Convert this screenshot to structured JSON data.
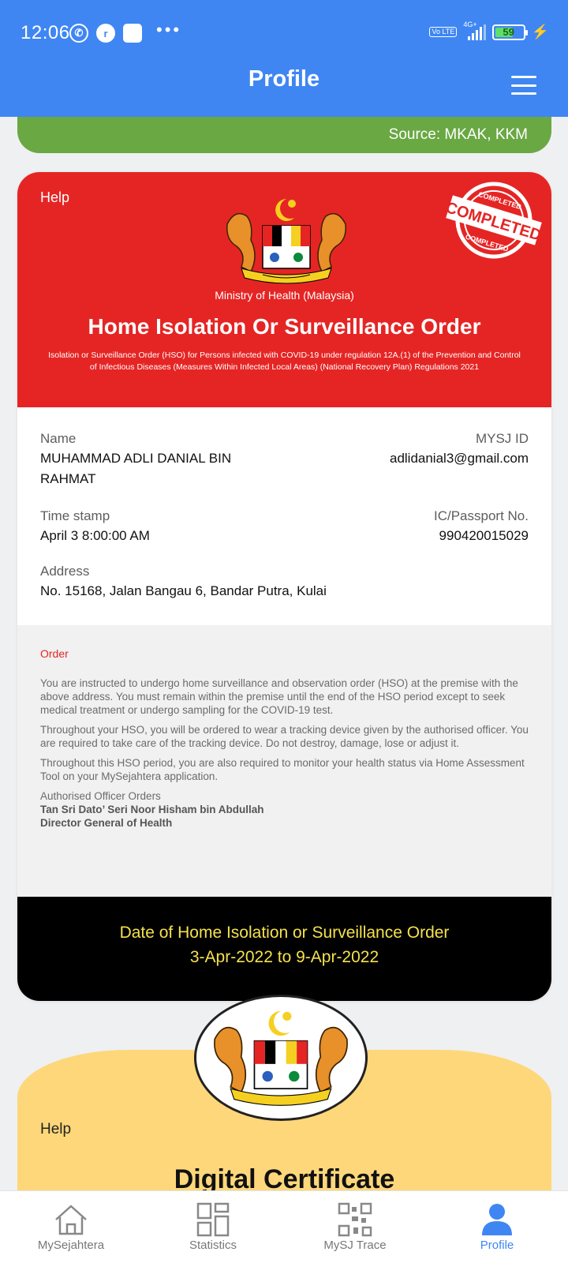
{
  "status_bar": {
    "time": "12:06",
    "network": "4G+",
    "volte": "Vo LTE",
    "battery": "59"
  },
  "header": {
    "title": "Profile"
  },
  "source_banner": {
    "text": "Source: MKAK, KKM"
  },
  "order_card": {
    "help": "Help",
    "stamp_text": "COMPLETED",
    "ministry": "Ministry of Health (Malaysia)",
    "title": "Home Isolation Or Surveillance Order",
    "subtitle": "Isolation or Surveillance Order (HSO) for Persons infected with COVID-19 under regulation 12A.(1) of the Prevention and Control of Infectious Diseases (Measures Within Infected Local Areas) (National Recovery Plan) Regulations 2021",
    "name_label": "Name",
    "name_line1": "MUHAMMAD ADLI DANIAL BIN",
    "name_line2": "RAHMAT",
    "mysj_label": "MYSJ ID",
    "mysj_value": "adlidanial3@gmail.com",
    "timestamp_label": "Time stamp",
    "timestamp_value": "April 3 8:00:00 AM",
    "ic_label": "IC/Passport No.",
    "ic_value": "990420015029",
    "address_label": "Address",
    "address_value": "No. 15168, Jalan Bangau 6, Bandar Putra, Kulai",
    "order_heading": "Order",
    "order_p1": "You are instructed to undergo home surveillance and observation order (HSO) at the premise with the above address. You must remain within the premise until the end of the HSO period except to seek medical treatment or undergo sampling for the COVID-19 test.",
    "order_p2": "Throughout your HSO, you will be ordered to wear a tracking device given by the authorised officer. You are required to take care of the tracking device. Do not destroy, damage, lose or adjust it.",
    "order_p3": "Throughout this HSO period, you are also required to monitor your health status via Home Assessment Tool on your MySejahtera application.",
    "officer_label": "Authorised Officer Orders",
    "officer_name": "Tan Sri Dato’ Seri Noor Hisham bin Abdullah",
    "officer_title": "Director General of Health",
    "date_heading": "Date of Home Isolation or Surveillance Order",
    "date_range": "3-Apr-2022 to 9-Apr-2022"
  },
  "cert_card": {
    "help": "Help",
    "title": "Digital Certificate"
  },
  "bottom_nav": [
    {
      "label": "MySejahtera",
      "icon": "home-icon"
    },
    {
      "label": "Statistics",
      "icon": "grid-icon"
    },
    {
      "label": "MySJ Trace",
      "icon": "qr-icon"
    },
    {
      "label": "Profile",
      "icon": "person-icon"
    }
  ],
  "colors": {
    "header_blue": "#3f86f3",
    "banner_green": "#6aa843",
    "order_red": "#e52524",
    "date_yellow": "#f4e14d",
    "cert_yellow": "#fdd77a"
  }
}
